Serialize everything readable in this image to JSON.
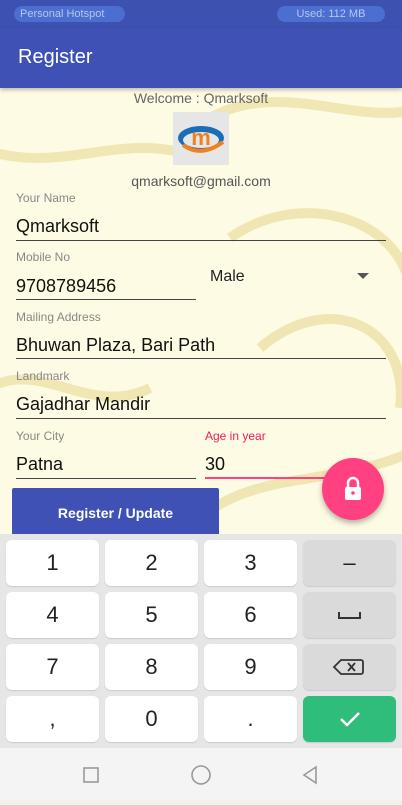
{
  "status_bar": {
    "hotspot": "Personal Hotspot",
    "data_used": "Used: 112 MB"
  },
  "app_bar": {
    "title": "Register"
  },
  "form": {
    "welcome": "Welcome : Qmarksoft",
    "email": "qmarksoft@gmail.com",
    "name_label": "Your Name",
    "name_value": "Qmarksoft",
    "mobile_label": "Mobile No",
    "mobile_value": "9708789456",
    "gender_value": "Male",
    "address_label": "Mailing Address",
    "address_value": "Bhuwan Plaza, Bari Path",
    "landmark_label": "Landmark",
    "landmark_value": "Gajadhar Mandir",
    "city_label": "Your City",
    "city_value": "Patna",
    "age_label": "Age in year",
    "age_value": "30",
    "register_button": "Register / Update"
  },
  "fab_icon": "lock-icon",
  "keyboard": {
    "keys": [
      "1",
      "2",
      "3",
      "–",
      "4",
      "5",
      "6",
      "␣",
      "7",
      "8",
      "9",
      "⌫",
      ",",
      "0",
      ".",
      "✓"
    ],
    "space_icon": "space-icon",
    "backspace_icon": "backspace-icon",
    "done_icon": "checkmark-icon"
  },
  "nav_bar": {
    "icons": [
      "recent-apps-icon",
      "home-icon",
      "back-icon"
    ]
  },
  "colors": {
    "primary": "#3f51b5",
    "accent": "#ff4081",
    "status_bar": "#3c51b0",
    "done_key": "#2ebd7b",
    "background": "#fdfbe3"
  }
}
